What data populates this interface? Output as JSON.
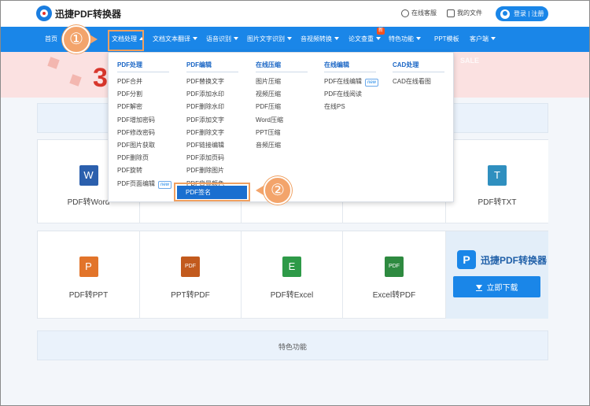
{
  "header": {
    "logo_text": "迅捷PDF转换器",
    "service_label": "在线客服",
    "files_label": "我的文件",
    "login_label": "登录 | 注册"
  },
  "nav": {
    "items": [
      "首页",
      "文档处理",
      "文档文本翻译",
      "语音识别",
      "图片文字识别",
      "音视频转换",
      "论文查重",
      "特色功能",
      "PPT模板",
      "客户端"
    ],
    "badge": "新"
  },
  "dropdown": {
    "columns": [
      {
        "title": "PDF处理",
        "items": [
          "PDF合并",
          "PDF分割",
          "PDF解密",
          "PDF增加密码",
          "PDF修改密码",
          "PDF图片获取",
          "PDF删除页",
          "PDF旋转",
          "PDF页面编辑"
        ],
        "new_index": 8
      },
      {
        "title": "PDF编辑",
        "items": [
          "PDF替换文字",
          "PDF添加水印",
          "PDF删除水印",
          "PDF添加文字",
          "PDF删除文字",
          "PDF链接编辑",
          "PDF添加页码",
          "PDF删除图片",
          "PDF背景颜色",
          "PDF签名"
        ],
        "selected_index": 9
      },
      {
        "title": "在线压缩",
        "items": [
          "图片压缩",
          "视频压缩",
          "PDF压缩",
          "Word压缩",
          "PPT压缩",
          "音频压缩"
        ]
      },
      {
        "title": "在线编辑",
        "items": [
          "PDF在线编辑",
          "PDF在线阅读",
          "在线PS"
        ],
        "new_index": 0
      },
      {
        "title": "CAD处理",
        "items": [
          "CAD在线看图"
        ]
      }
    ],
    "new_tag": "new"
  },
  "banner": {
    "big_text": "3",
    "sale_text": "SALE"
  },
  "tools_row1": [
    {
      "label": "PDF转Word",
      "icon": "W",
      "color": "#2b5fad"
    },
    {
      "label": "",
      "icon": "",
      "color": "#ffffff"
    },
    {
      "label": "",
      "icon": "",
      "color": "#ffffff"
    },
    {
      "label": "",
      "icon": "",
      "color": "#ffffff"
    },
    {
      "label": "",
      "icon": "",
      "color": "#ffffff"
    },
    {
      "label": "PDF转TXT",
      "icon": "T",
      "color": "#2f8fbf"
    }
  ],
  "tools_row2": [
    {
      "label": "PDF转PPT",
      "icon": "P",
      "color": "#e2742a"
    },
    {
      "label": "PPT转PDF",
      "icon": "PDF",
      "color": "#c25a1d"
    },
    {
      "label": "PDF转Excel",
      "icon": "E",
      "color": "#2e9a48"
    },
    {
      "label": "Excel转PDF",
      "icon": "PDF",
      "color": "#2e8a40"
    }
  ],
  "download": {
    "logo_mark": "P",
    "logo_text": "迅捷PDF转换器",
    "button_label": "立即下载"
  },
  "featured_label": "特色功能",
  "steps": [
    "①",
    "②"
  ],
  "colors": {
    "brand_blue": "#1a86e8",
    "highlight_orange": "#f0a060",
    "selected_blue": "#1a6fd0"
  }
}
